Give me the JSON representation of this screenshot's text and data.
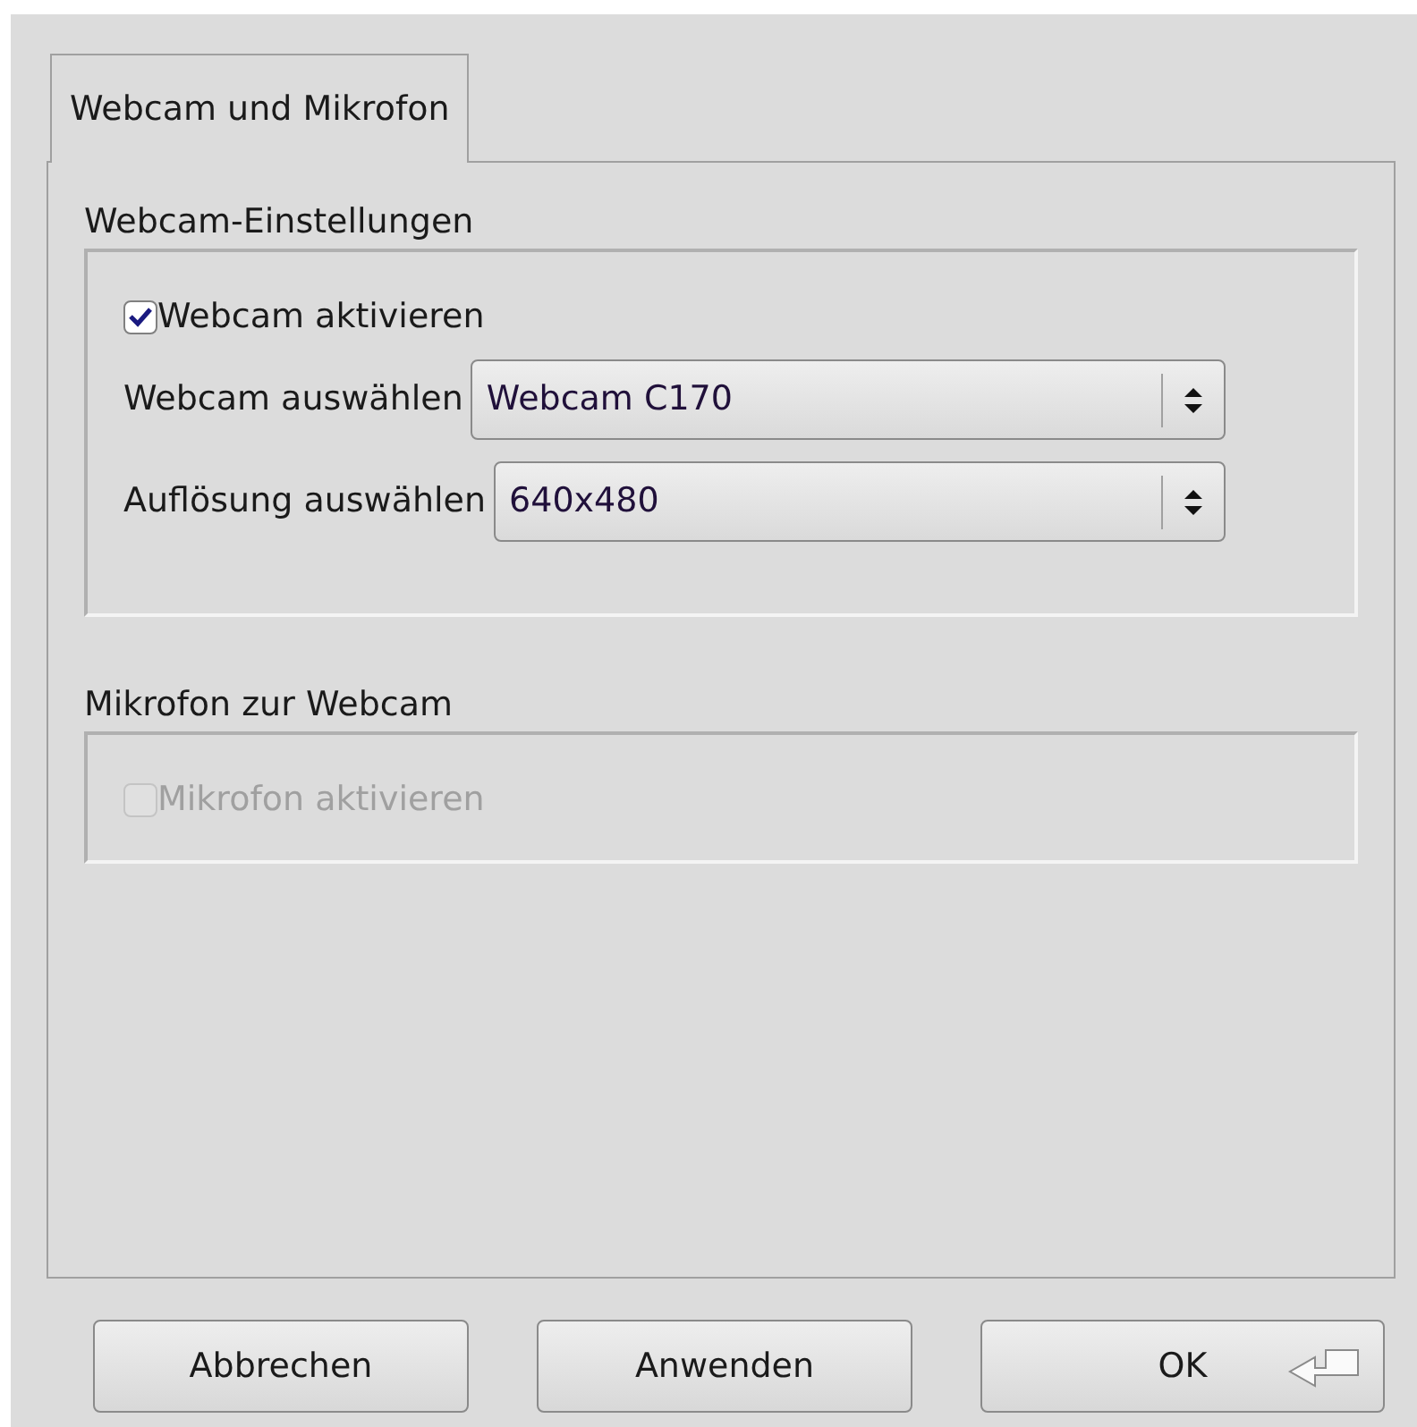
{
  "tabs": [
    {
      "label": "Webcam und Mikrofon",
      "selected": true
    }
  ],
  "groups": [
    {
      "title": "Webcam-Einstellungen",
      "checkbox": {
        "label": "Webcam aktivieren",
        "checked": true,
        "disabled": false
      },
      "combos": [
        {
          "label": "Webcam auswählen",
          "value": "Webcam C170"
        },
        {
          "label": "Auflösung auswählen",
          "value": "640x480"
        }
      ]
    },
    {
      "title": "Mikrofon zur Webcam",
      "checkbox": {
        "label": "Mikrofon aktivieren",
        "checked": false,
        "disabled": true
      }
    }
  ],
  "buttons": [
    {
      "label": "Abbrechen",
      "default": false
    },
    {
      "label": "Anwenden",
      "default": false
    },
    {
      "label": "OK",
      "default": true
    }
  ]
}
